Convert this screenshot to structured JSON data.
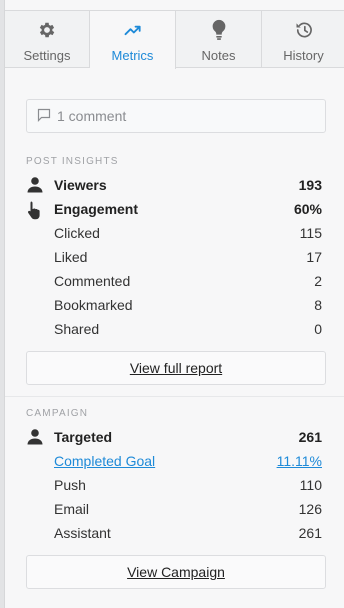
{
  "tabs": [
    {
      "label": "Settings",
      "icon": "gear-icon"
    },
    {
      "label": "Metrics",
      "icon": "trending-up-icon"
    },
    {
      "label": "Notes",
      "icon": "lightbulb-icon"
    },
    {
      "label": "History",
      "icon": "history-icon"
    }
  ],
  "active_tab": "Metrics",
  "comment": {
    "text": "1 comment",
    "icon": "comment-icon"
  },
  "post_insights": {
    "title": "POST INSIGHTS",
    "rows": [
      {
        "label": "Viewers",
        "value": "193",
        "icon": "person-icon"
      },
      {
        "label": "Engagement",
        "value": "60%",
        "icon": "pointer-hand-icon"
      },
      {
        "label": "Clicked",
        "value": "115"
      },
      {
        "label": "Liked",
        "value": "17"
      },
      {
        "label": "Commented",
        "value": "2"
      },
      {
        "label": "Bookmarked",
        "value": "8"
      },
      {
        "label": "Shared",
        "value": "0"
      }
    ],
    "button": "View full report"
  },
  "campaign": {
    "title": "CAMPAIGN",
    "rows": [
      {
        "label": "Targeted",
        "value": "261",
        "icon": "person-icon"
      },
      {
        "label": "Completed Goal",
        "value": "11.11%"
      },
      {
        "label": "Push",
        "value": "110"
      },
      {
        "label": "Email",
        "value": "126"
      },
      {
        "label": "Assistant",
        "value": "261"
      }
    ],
    "button": "View Campaign"
  },
  "colors": {
    "accent": "#1e8ad8",
    "text": "#333333",
    "muted": "#a0a2a6"
  }
}
